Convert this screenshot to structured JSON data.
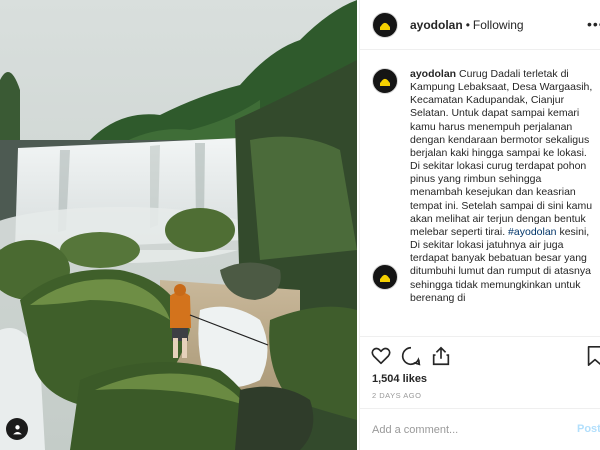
{
  "photo": {
    "alt_icon": "waterfall-photo",
    "tag_icon": "user-tag-icon"
  },
  "header": {
    "username": "ayodolan",
    "separator": "•",
    "follow_status": "Following",
    "more_icon": "more-options-icon"
  },
  "caption": {
    "username": "ayodolan",
    "text_before_hashtag": "Curug Dadali terletak di Kampung Lebaksaat, Desa Wargaasih, Kecamatan Kadupandak, Cianjur Selatan. Untuk dapat sampai kemari kamu harus menempuh perjalanan dengan kendaraan bermotor sekaligus berjalan kaki hingga sampai ke lokasi. Di sekitar lokasi curug terdapat pohon pinus yang rimbun sehingga menambah kesejukan dan keasrian tempat ini. Setelah sampai di sini kamu akan melihat air terjun dengan bentuk melebar seperti tirai.",
    "hashtag": "#ayodolan",
    "text_after_hashtag": "kesini, Di sekitar lokasi jatuhnya air juga terdapat banyak bebatuan besar yang ditumbuhi lumut dan rumput di atasnya sehingga tidak memungkinkan untuk berenang di"
  },
  "actions": {
    "like_icon": "heart-icon",
    "comment_icon": "comment-icon",
    "share_icon": "share-icon",
    "save_icon": "bookmark-icon",
    "likes": "1,504 likes",
    "time": "2 DAYS AGO"
  },
  "comment_box": {
    "placeholder": "Add a comment...",
    "post_label": "Post"
  },
  "colors": {
    "text": "#262626",
    "muted": "#999999",
    "border": "#efefef",
    "hashtag": "#003569",
    "post_disabled": "#b2dffc"
  }
}
